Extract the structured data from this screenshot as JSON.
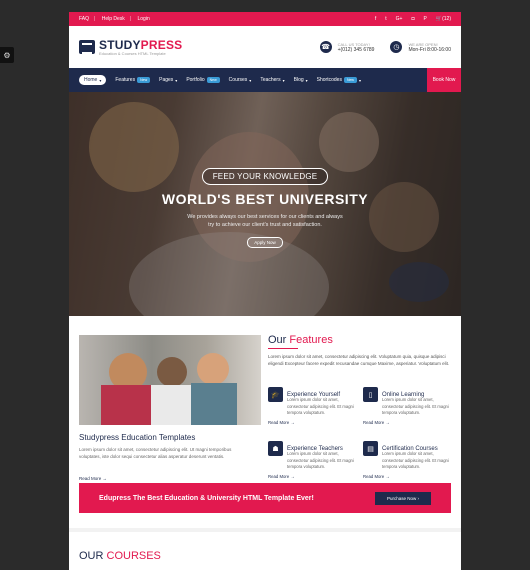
{
  "topbar": {
    "links": [
      "FAQ",
      "Help Desk",
      "Login"
    ],
    "social_icons": [
      "facebook-icon",
      "twitter-icon",
      "google-plus-icon",
      "instagram-icon",
      "pinterest-icon"
    ],
    "cart": "(12)"
  },
  "header": {
    "logo_primary": "STUDY",
    "logo_accent": "PRESS",
    "logo_sub": "Education & Courses HTML Template",
    "call_label": "CALL US TODAY!",
    "call_value": "+(012) 345 6789",
    "open_label": "WE ARE OPEN!",
    "open_value": "Mon-Fri 8:00-16:00"
  },
  "nav": {
    "items": [
      {
        "label": "Home",
        "badge": ""
      },
      {
        "label": "Features",
        "badge": "New"
      },
      {
        "label": "Pages",
        "badge": ""
      },
      {
        "label": "Portfolio",
        "badge": "New"
      },
      {
        "label": "Courses",
        "badge": ""
      },
      {
        "label": "Teachers",
        "badge": ""
      },
      {
        "label": "Blog",
        "badge": ""
      },
      {
        "label": "Shortcodes",
        "badge": "New"
      }
    ],
    "book": "Book Now"
  },
  "hero": {
    "pill": "FEED YOUR KNOWLEDGE",
    "title": "WORLD'S BEST UNIVERSITY",
    "text": "We provides always our best services for our clients and always try to achieve our client's trust and satisfaction.",
    "button": "Apply Now"
  },
  "features": {
    "left_title": "Studypress Education Templates",
    "left_text": "Lorem ipsum dolor sit amet, consectetur adipiscing elit. Ut magni temporibus voluptates, iste dolor sequi consectetur alias asperatur deserunt ventatis.",
    "left_more": "Read More →",
    "title_main": "Our ",
    "title_accent": "Features",
    "text": "Lorem ipsum dolor sit amet, consectetur adipiscing elit. Voluptatum quia, quisque adipisci eligendi Excepteur facere expedit recusandae cumque Maxime, asperiatur. Voluptatum elit.",
    "items": [
      {
        "icon": "graduation-icon",
        "name": "Experience Yourself",
        "desc": "Lorem ipsum dolor sit amet, consectetur adipiscing elit. Et magni tempora voluptatum.",
        "more": "Read More →"
      },
      {
        "icon": "mobile-icon",
        "name": "Online Learning",
        "desc": "Lorem ipsum dolor sit amet, consectetur adipiscing elit. Et magni tempora voluptatum.",
        "more": "Read More →"
      },
      {
        "icon": "teacher-icon",
        "name": "Experience Teachers",
        "desc": "Lorem ipsum dolor sit amet, consectetur adipiscing elit. Et magni tempora voluptatum.",
        "more": "Read More →"
      },
      {
        "icon": "certificate-icon",
        "name": "Certification Courses",
        "desc": "Lorem ipsum dolor sit amet, consectetur adipiscing elit. Et magni tempora voluptatum.",
        "more": "Read More →"
      }
    ]
  },
  "banner": {
    "text": "Edupress The Best Education & University HTML Template Ever!",
    "button": "Purchase Now"
  },
  "courses": {
    "title_main": "OUR ",
    "title_accent": "COURSES"
  },
  "colors": {
    "accent": "#e2194f",
    "navy": "#1e2a4c"
  }
}
